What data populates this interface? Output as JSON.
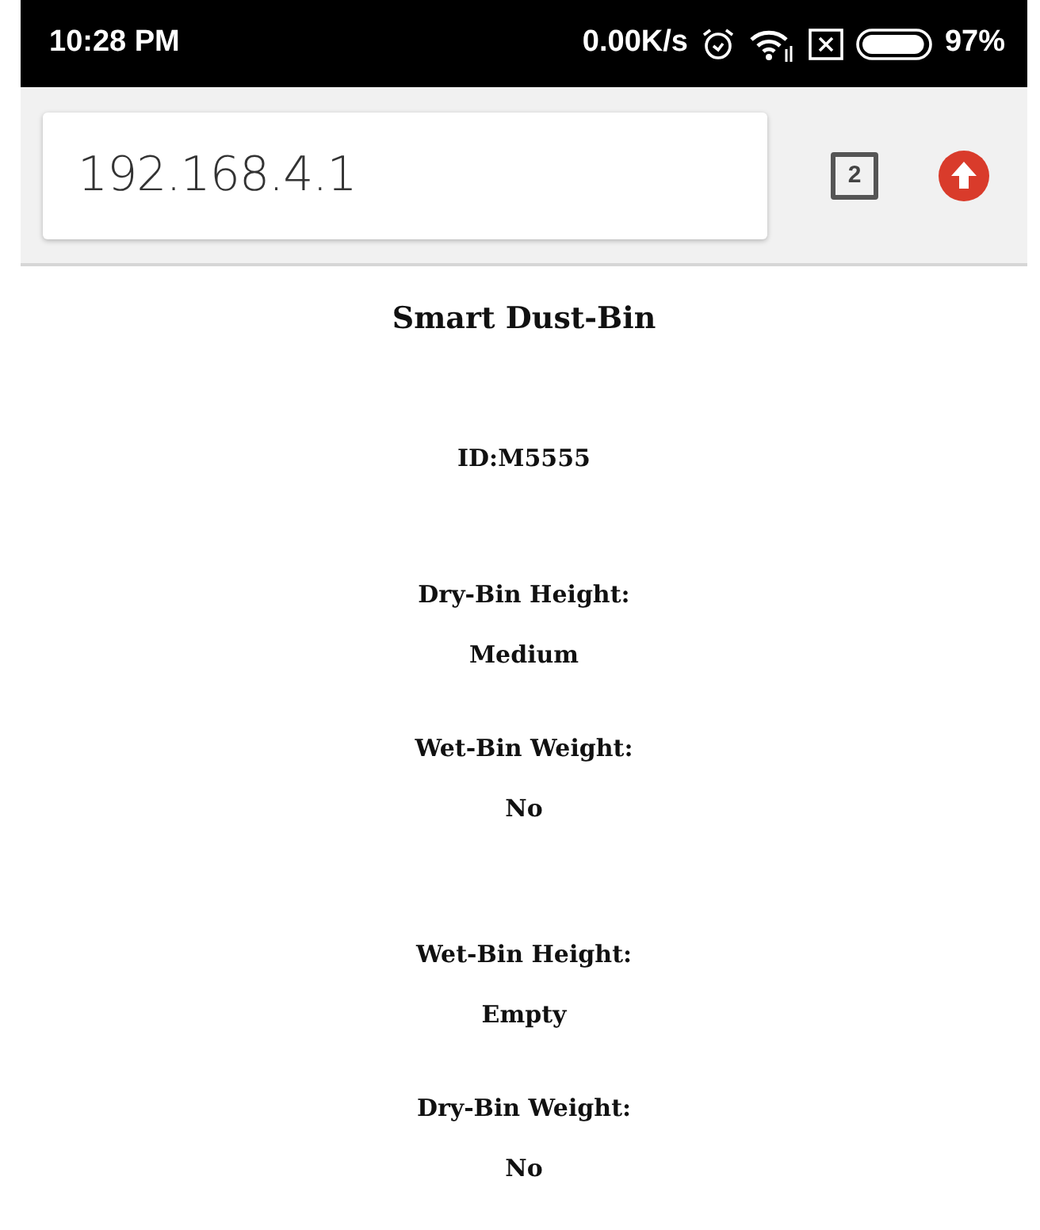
{
  "status_bar": {
    "time": "10:28 PM",
    "net_speed": "0.00K/s",
    "battery": "97%",
    "battery_icon": {
      "level": 0.97
    }
  },
  "browser": {
    "url": "192.168.4.1",
    "tab_count": "2"
  },
  "page": {
    "title": "Smart Dust-Bin",
    "id": "ID:M5555",
    "fields": [
      {
        "label": "Dry-Bin Height:",
        "value": "Medium"
      },
      {
        "label": "Wet-Bin Weight:",
        "value": "No"
      },
      {
        "label": "Wet-Bin Height:",
        "value": "Empty"
      },
      {
        "label": "Dry-Bin Weight:",
        "value": "No"
      }
    ]
  }
}
